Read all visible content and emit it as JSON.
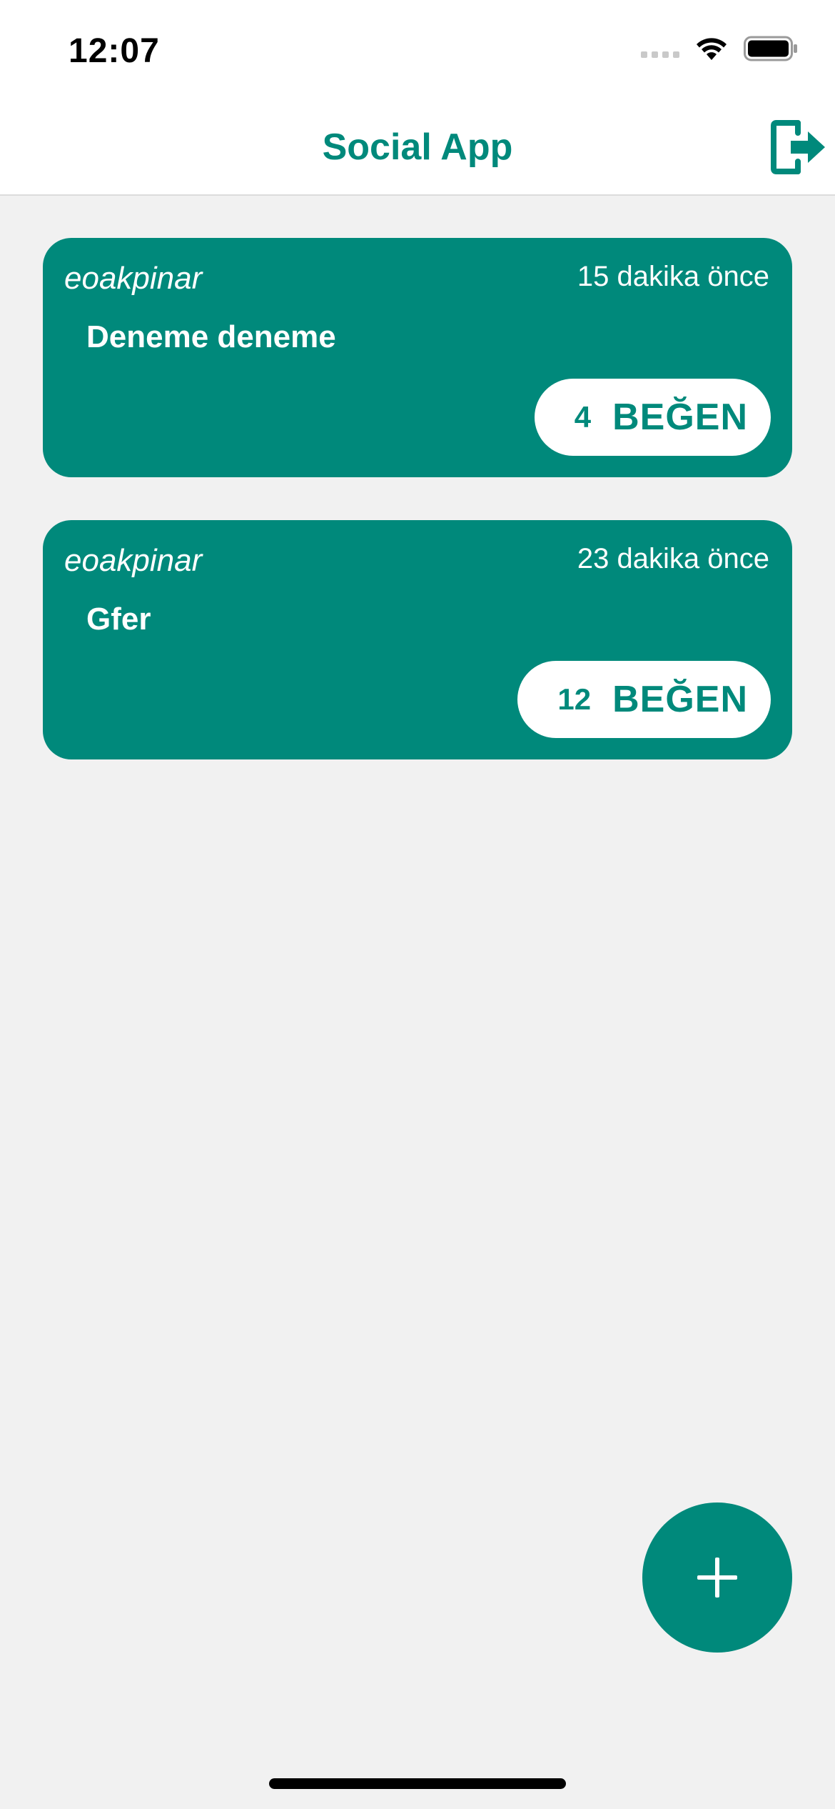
{
  "status_bar": {
    "time": "12:07"
  },
  "nav": {
    "title": "Social App"
  },
  "posts": [
    {
      "author": "eoakpinar",
      "time": "15 dakika önce",
      "body": "Deneme deneme",
      "like_count": "4",
      "like_label": "BEĞEN"
    },
    {
      "author": "eoakpinar",
      "time": "23 dakika önce",
      "body": "Gfer",
      "like_count": "12",
      "like_label": "BEĞEN"
    }
  ],
  "colors": {
    "accent": "#00897b",
    "background": "#f1f1f1",
    "surface": "#ffffff"
  },
  "icons": {
    "logout": "logout-icon",
    "add": "plus-icon",
    "wifi": "wifi-icon",
    "battery": "battery-icon",
    "signal": "signal-icon"
  }
}
